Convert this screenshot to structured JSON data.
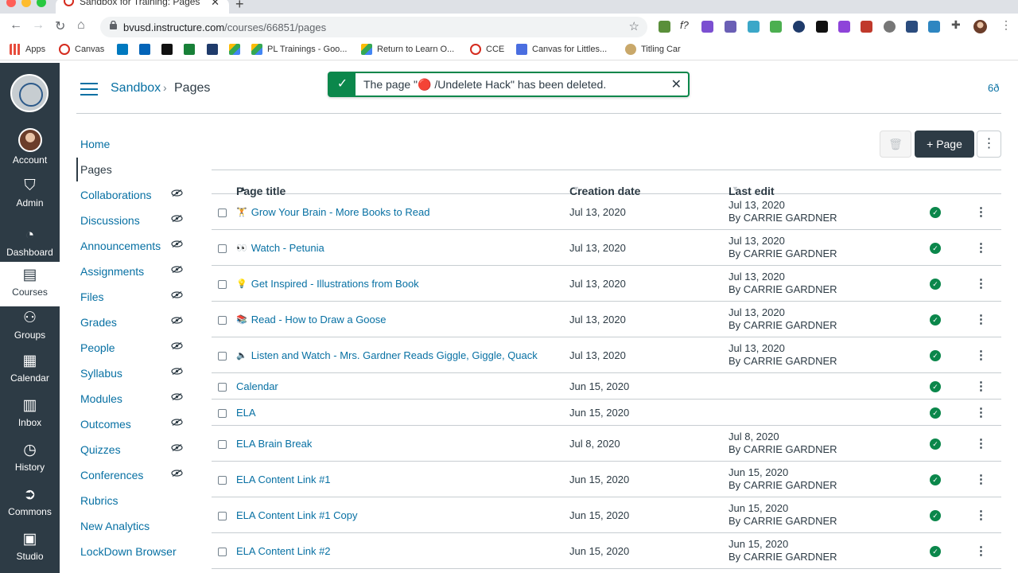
{
  "browser": {
    "tab_title": "Sandbox for Training: Pages",
    "new_tab": "+",
    "url_domain": "bvusd.instructure.com",
    "url_path": "/courses/66851/pages",
    "bookmarks": [
      "Apps",
      "Canvas",
      "PL Trainings - Goo...",
      "Return to Learn O...",
      "CCE",
      "Canvas for Littles...",
      "Titling Car"
    ]
  },
  "global_nav": {
    "items": [
      {
        "label": "Account",
        "icon": "avatar"
      },
      {
        "label": "Admin",
        "icon": "shield-icon"
      },
      {
        "label": "Dashboard",
        "icon": "gauge-icon"
      },
      {
        "label": "Courses",
        "icon": "book-icon"
      },
      {
        "label": "Groups",
        "icon": "people-icon"
      },
      {
        "label": "Calendar",
        "icon": "calendar-icon"
      },
      {
        "label": "Inbox",
        "icon": "inbox-icon"
      },
      {
        "label": "History",
        "icon": "clock-icon"
      },
      {
        "label": "Commons",
        "icon": "commons-icon"
      },
      {
        "label": "Studio",
        "icon": "studio-icon"
      }
    ]
  },
  "header": {
    "course": "Sandbox",
    "separator": "›",
    "current": "Pages"
  },
  "flash": {
    "message": "The page \"🔴 /Undelete Hack\" has been deleted.",
    "close": "✕"
  },
  "course_nav": [
    {
      "label": "Home",
      "hidden": false
    },
    {
      "label": "Pages",
      "hidden": false,
      "current": true
    },
    {
      "label": "Collaborations",
      "hidden": true
    },
    {
      "label": "Discussions",
      "hidden": true
    },
    {
      "label": "Announcements",
      "hidden": true
    },
    {
      "label": "Assignments",
      "hidden": true
    },
    {
      "label": "Files",
      "hidden": true
    },
    {
      "label": "Grades",
      "hidden": true
    },
    {
      "label": "People",
      "hidden": true
    },
    {
      "label": "Syllabus",
      "hidden": true
    },
    {
      "label": "Modules",
      "hidden": true
    },
    {
      "label": "Outcomes",
      "hidden": true
    },
    {
      "label": "Quizzes",
      "hidden": true
    },
    {
      "label": "Conferences",
      "hidden": true
    },
    {
      "label": "Rubrics",
      "hidden": false
    },
    {
      "label": "New Analytics",
      "hidden": false
    },
    {
      "label": "LockDown Browser",
      "hidden": false
    }
  ],
  "toolbar": {
    "page_button": "Page",
    "page_button_plus": "+"
  },
  "table": {
    "headers": {
      "title": "Page title",
      "created": "Creation date",
      "edited": "Last edit"
    },
    "rows": [
      {
        "emoji": "🏋",
        "title": "Grow Your Brain - More Books to Read",
        "created": "Jul 13, 2020",
        "edit_date": "Jul 13, 2020",
        "edit_by": "By CARRIE GARDNER"
      },
      {
        "emoji": "👀",
        "title": "Watch - Petunia",
        "created": "Jul 13, 2020",
        "edit_date": "Jul 13, 2020",
        "edit_by": "By CARRIE GARDNER"
      },
      {
        "emoji": "💡",
        "title": "Get Inspired - Illustrations from Book",
        "created": "Jul 13, 2020",
        "edit_date": "Jul 13, 2020",
        "edit_by": "By CARRIE GARDNER"
      },
      {
        "emoji": "📚",
        "title": "Read - How to Draw a Goose",
        "created": "Jul 13, 2020",
        "edit_date": "Jul 13, 2020",
        "edit_by": "By CARRIE GARDNER"
      },
      {
        "emoji": "🔈",
        "title": "Listen and Watch - Mrs. Gardner Reads Giggle, Giggle, Quack",
        "created": "Jul 13, 2020",
        "edit_date": "Jul 13, 2020",
        "edit_by": "By CARRIE GARDNER"
      },
      {
        "emoji": "",
        "title": "Calendar",
        "created": "Jun 15, 2020",
        "edit_date": "",
        "edit_by": ""
      },
      {
        "emoji": "",
        "title": "ELA",
        "created": "Jun 15, 2020",
        "edit_date": "",
        "edit_by": ""
      },
      {
        "emoji": "",
        "title": "ELA Brain Break",
        "created": "Jul 8, 2020",
        "edit_date": "Jul 8, 2020",
        "edit_by": "By CARRIE GARDNER"
      },
      {
        "emoji": "",
        "title": "ELA Content Link #1",
        "created": "Jun 15, 2020",
        "edit_date": "Jun 15, 2020",
        "edit_by": "By CARRIE GARDNER"
      },
      {
        "emoji": "",
        "title": "ELA Content Link #1 Copy",
        "created": "Jun 15, 2020",
        "edit_date": "Jun 15, 2020",
        "edit_by": "By CARRIE GARDNER"
      },
      {
        "emoji": "",
        "title": "ELA Content Link #2",
        "created": "Jun 15, 2020",
        "edit_date": "Jun 15, 2020",
        "edit_by": "By CARRIE GARDNER"
      }
    ]
  },
  "colors": {
    "link": "#0770a3",
    "nav_bg": "#2d3b45",
    "success": "#0b874b"
  }
}
